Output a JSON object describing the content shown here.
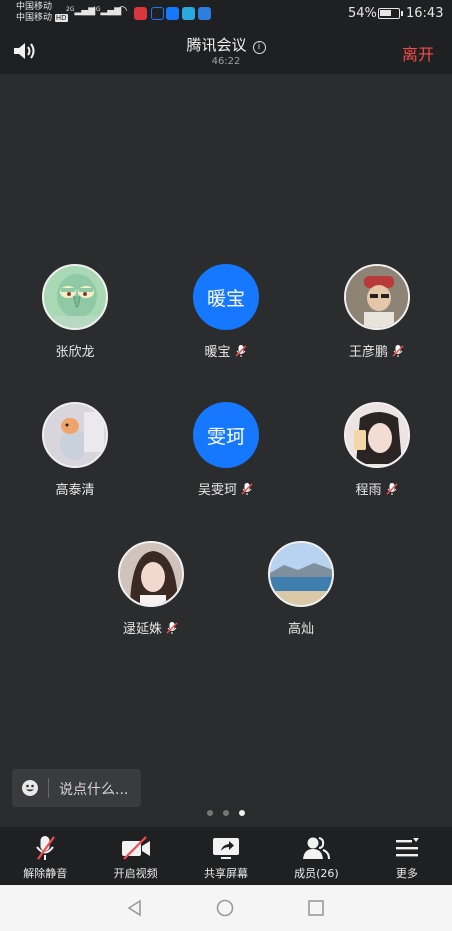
{
  "status_bar": {
    "carrier_1": "中国移动",
    "carrier_2": "中国移动",
    "hd_badge": "HD",
    "net_1": "2G",
    "net_2": "4G",
    "battery": "54%",
    "time": "16:43"
  },
  "header": {
    "title": "腾讯会议",
    "duration": "46:22",
    "leave": "离开",
    "info_symbol": "i"
  },
  "participants": [
    {
      "name": "张欣龙",
      "avatar_type": "photo",
      "avatar_text": "",
      "muted": false
    },
    {
      "name": "暖宝",
      "avatar_type": "initials",
      "avatar_text": "暖宝",
      "muted": true
    },
    {
      "name": "王彦鹏",
      "avatar_type": "photo",
      "avatar_text": "",
      "muted": true
    },
    {
      "name": "高泰清",
      "avatar_type": "photo",
      "avatar_text": "",
      "muted": false
    },
    {
      "name": "吴雯珂",
      "avatar_type": "initials",
      "avatar_text": "雯珂",
      "muted": true
    },
    {
      "name": "程雨",
      "avatar_type": "photo",
      "avatar_text": "",
      "muted": true
    },
    {
      "name": "逯延姝",
      "avatar_type": "photo",
      "avatar_text": "",
      "muted": true
    },
    {
      "name": "高灿",
      "avatar_type": "photo",
      "avatar_text": "",
      "muted": false
    }
  ],
  "chat": {
    "placeholder": "说点什么..."
  },
  "pager": {
    "pages": 3,
    "current": 3
  },
  "toolbar": {
    "unmute": "解除静音",
    "video": "开启视频",
    "share": "共享屏幕",
    "members": "成员(26)",
    "more": "更多"
  },
  "colors": {
    "accent_blue": "#1677ff",
    "leave_red": "#f24d4d",
    "background": "#2b2c2e",
    "bar": "#1f2022"
  }
}
